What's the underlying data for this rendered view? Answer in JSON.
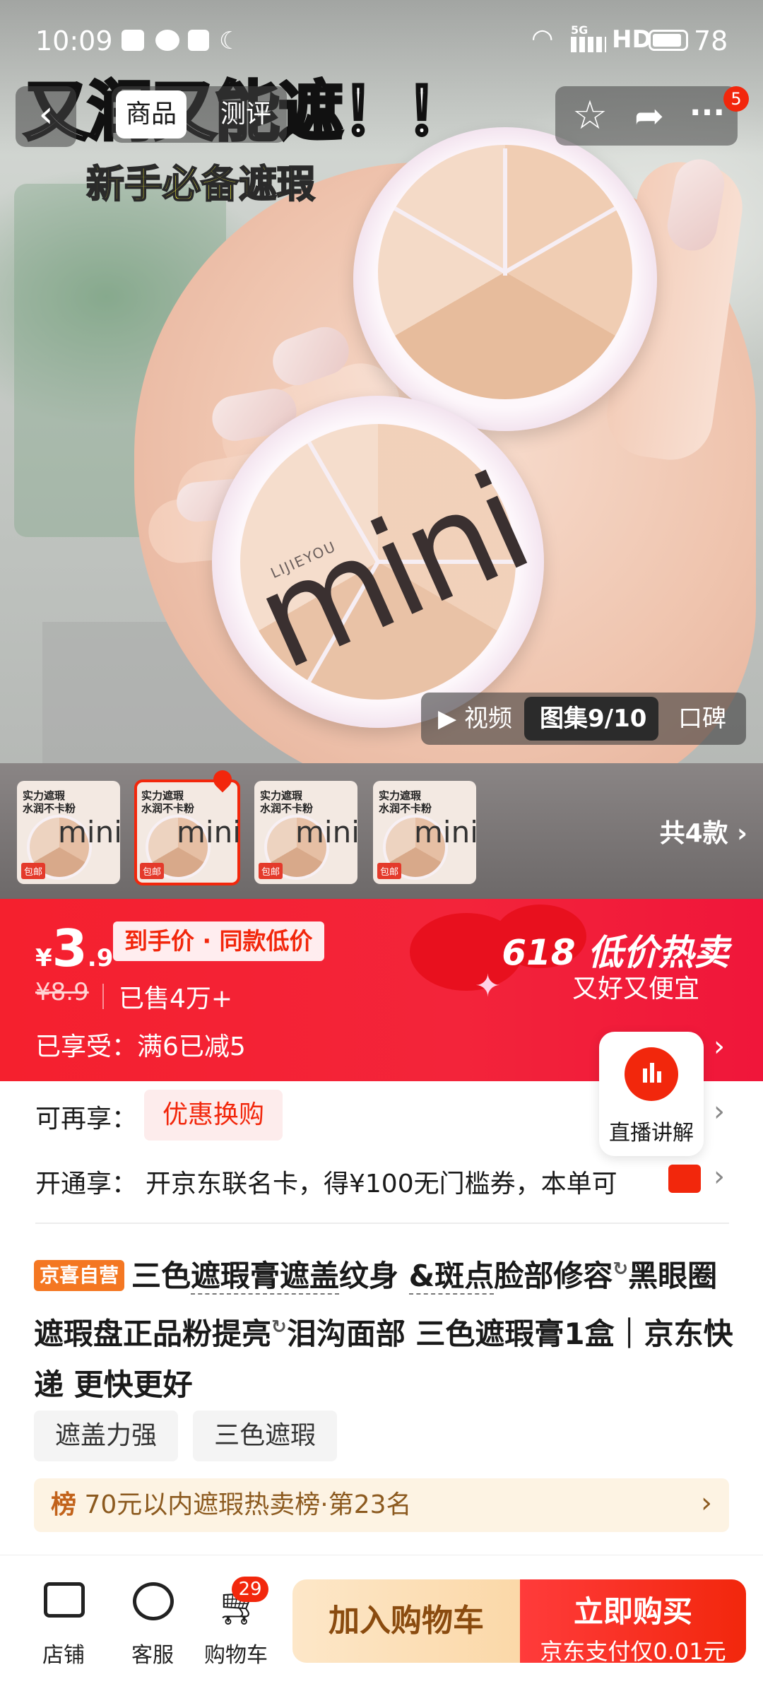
{
  "status_bar": {
    "time": "10:09",
    "network": "5G",
    "hd": "HD",
    "battery": "78"
  },
  "nav": {
    "tabs": [
      {
        "label": "商品"
      },
      {
        "label": "测评"
      }
    ],
    "more_badge": "5"
  },
  "hero": {
    "headline": "又润又能遮！！",
    "subline": "新手必备遮瑕",
    "product_text": "mini",
    "brand": "LIJIEYOU",
    "media_tabs": [
      {
        "label": "▶ 视频"
      },
      {
        "label": "图集9/10"
      },
      {
        "label": "口碑"
      }
    ]
  },
  "thumbs": {
    "top_text": "实力遮瑕\n水润不卡粉",
    "mini": "mini",
    "tag": "包邮",
    "count_label": "共4款"
  },
  "price": {
    "currency": "¥",
    "integer": "3",
    "decimal": ".9",
    "tag": "到手价 · 同款低价",
    "original": "¥8.9",
    "sold": "已售4万+",
    "enjoyed": "已享受：满6已减5",
    "promo_title": "618 低价热卖",
    "promo_sub": "又好又便宜"
  },
  "offers": {
    "more_label": "可再享：",
    "more_chip": "优惠换购",
    "open_label": "开通享：",
    "open_text": "开京东联名卡，得¥100无门槛券，本单可",
    "live_label": "直播讲解"
  },
  "title": {
    "self_tag": "京喜自营",
    "part1": "三色",
    "dotted1": "遮瑕膏遮盖",
    "part2": "纹身 ",
    "dotted2": "&斑点",
    "part3": "脸部修容",
    "part4": "黑眼圈遮瑕盘正品粉提亮",
    "part5": "泪沟面部 三色遮瑕膏1盒｜京东快递 更快更好"
  },
  "features": [
    "遮盖力强",
    "三色遮瑕"
  ],
  "rank": {
    "icon": "榜",
    "text": "70元以内遮瑕热卖榜·第23名"
  },
  "bottom": {
    "store": "店铺",
    "service": "客服",
    "cart": "购物车",
    "cart_badge": "29",
    "add_cart": "加入购物车",
    "buy_now": "立即购买",
    "buy_sub": "京东支付仅0.01元"
  },
  "colors": {
    "jd_red": "#f2270c",
    "gold_button": "#fbd8a8",
    "self_tag": "#f47722"
  }
}
